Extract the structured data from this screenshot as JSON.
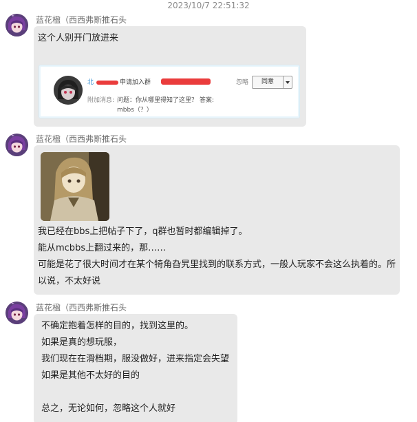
{
  "timestamp": "2023/10/7 22:51:32",
  "messages": [
    {
      "sender": "蓝花楹（西西弗斯推石头",
      "text": "这个人别开门放进来",
      "join_request": {
        "name_prefix": "北",
        "action": "申请加入群",
        "ignore_label": "忽略",
        "agree_label": "同意",
        "extra_label": "附加消息:",
        "question": "问题：你从哪里得知了这里？ 答案:",
        "answer": "mbbs（？）"
      }
    },
    {
      "sender": "蓝花楹（西西弗斯推石头",
      "lines": [
        "我已经在bbs上把帖子下了，q群也暂时都编辑掉了。",
        "能从mcbbs上翻过来的，那……",
        "可能是花了很大时间才在某个犄角旮旯里找到的联系方式，一般人玩家不会这么执着的。所",
        "以说，不太好说"
      ]
    },
    {
      "sender": "蓝花楹（西西弗斯推石头",
      "lines": [
        "不确定抱着怎样的目的，找到这里的。",
        "如果是真的想玩服，",
        "我们现在在滑档期，服没做好，进来指定会失望",
        "如果是其他不太好的目的",
        "",
        "总之，无论如何，忽略这个人就好"
      ]
    }
  ],
  "icons": {
    "avatar": "anime-avatar-icon",
    "card_avatar": "requester-avatar-icon",
    "dropdown": "chevron-down-icon"
  },
  "colors": {
    "bubble": "#e9e9e9",
    "redaction": "#ea3c3c",
    "link": "#2a8ad0"
  }
}
